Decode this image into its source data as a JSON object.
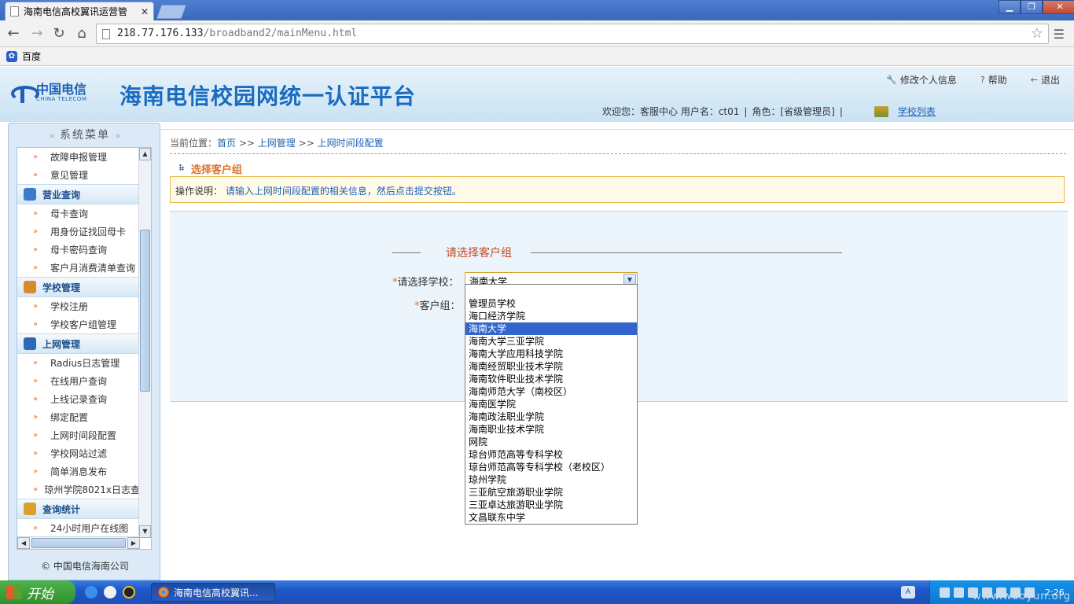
{
  "browser": {
    "tab_title": "海南电信高校翼讯运营管",
    "tab_close": "✕",
    "url_host": "218.77.176.133",
    "url_path": "/broadband2/mainMenu.html",
    "bookmark_label": "百度",
    "win_minimize": "▁",
    "win_restore": "❐",
    "win_close": "✕"
  },
  "header": {
    "logo_cn": "中国电信",
    "logo_en": "CHINA TELECOM",
    "title": "海南电信校园网统一认证平台",
    "links": {
      "profile": "修改个人信息",
      "help": "帮助",
      "logout": "退出"
    },
    "welcome": "欢迎您：客服中心 用户名：ct01",
    "role": "角色：[省级管理员]",
    "school_list": "学校列表"
  },
  "sidebar": {
    "title": "系统菜单",
    "items_top": [
      "故障申报管理",
      "意见管理"
    ],
    "group_business": "营业查询",
    "items_business": [
      "母卡查询",
      "用身份证找回母卡",
      "母卡密码查询",
      "客户月消费清单查询"
    ],
    "group_school": "学校管理",
    "items_school": [
      "学校注册",
      "学校客户组管理"
    ],
    "group_network": "上网管理",
    "items_network": [
      "Radius日志管理",
      "在线用户查询",
      "上线记录查询",
      "绑定配置",
      "上网时间段配置",
      "学校网站过滤",
      "简单消息发布",
      "琼州学院8021x日志查"
    ],
    "group_stats": "查询统计",
    "items_stats": [
      "24小时用户在线图"
    ],
    "footer": "© 中国电信海南公司"
  },
  "main": {
    "breadcrumb_prefix": "当前位置：",
    "breadcrumb_home": "首页",
    "breadcrumb_sep": ">>",
    "breadcrumb_section": "上网管理",
    "breadcrumb_page": "上网时间段配置",
    "section_title": "选择客户组",
    "notice_label": "操作说明：",
    "notice_text": "请输入上网时间段配置的相关信息，然后点击提交按钮。",
    "form_legend": "请选择客户组",
    "school_label": "请选择学校：",
    "group_label": "客户组：",
    "required_mark": "*",
    "school_selected": "海南大学",
    "school_options": [
      "",
      "管理员学校",
      "海口经济学院",
      "海南大学",
      "海南大学三亚学院",
      "海南大学应用科技学院",
      "海南经贸职业技术学院",
      "海南软件职业技术学院",
      "海南师范大学（南校区）",
      "海南医学院",
      "海南政法职业学院",
      "海南职业技术学院",
      "网院",
      "琼台师范高等专科学校",
      "琼台师范高等专科学校（老校区）",
      "琼州学院",
      "三亚航空旅游职业学院",
      "三亚卓达旅游职业学院",
      "文昌联东中学"
    ]
  },
  "taskbar": {
    "start_label": "开始",
    "task_title": "海南电信高校翼讯...",
    "clock": "2:26"
  },
  "watermark": "www.wooyun.org"
}
